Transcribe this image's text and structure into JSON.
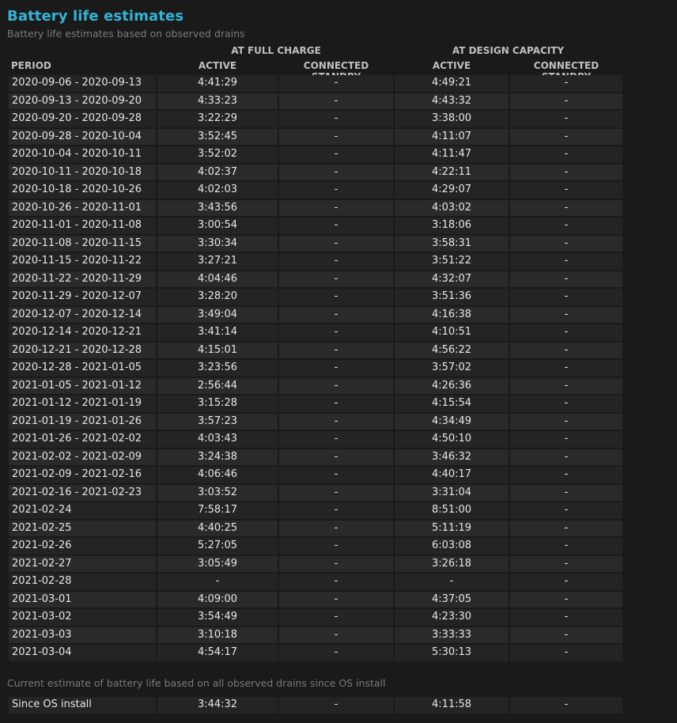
{
  "section": {
    "title": "Battery life estimates",
    "subtitle": "Battery life estimates based on observed drains"
  },
  "header": {
    "group_full": "AT FULL CHARGE",
    "group_design": "AT DESIGN CAPACITY",
    "period": "PERIOD",
    "active_full": "ACTIVE",
    "standby_full": "CONNECTED STANDBY",
    "active_design": "ACTIVE",
    "standby_design": "CONNECTED STANDBY"
  },
  "rows": [
    {
      "period": "2020-09-06 - 2020-09-13",
      "active_full": "4:41:29",
      "standby_full": "-",
      "active_design": "4:49:21",
      "standby_design": "-"
    },
    {
      "period": "2020-09-13 - 2020-09-20",
      "active_full": "4:33:23",
      "standby_full": "-",
      "active_design": "4:43:32",
      "standby_design": "-"
    },
    {
      "period": "2020-09-20 - 2020-09-28",
      "active_full": "3:22:29",
      "standby_full": "-",
      "active_design": "3:38:00",
      "standby_design": "-"
    },
    {
      "period": "2020-09-28 - 2020-10-04",
      "active_full": "3:52:45",
      "standby_full": "-",
      "active_design": "4:11:07",
      "standby_design": "-"
    },
    {
      "period": "2020-10-04 - 2020-10-11",
      "active_full": "3:52:02",
      "standby_full": "-",
      "active_design": "4:11:47",
      "standby_design": "-"
    },
    {
      "period": "2020-10-11 - 2020-10-18",
      "active_full": "4:02:37",
      "standby_full": "-",
      "active_design": "4:22:11",
      "standby_design": "-"
    },
    {
      "period": "2020-10-18 - 2020-10-26",
      "active_full": "4:02:03",
      "standby_full": "-",
      "active_design": "4:29:07",
      "standby_design": "-"
    },
    {
      "period": "2020-10-26 - 2020-11-01",
      "active_full": "3:43:56",
      "standby_full": "-",
      "active_design": "4:03:02",
      "standby_design": "-"
    },
    {
      "period": "2020-11-01 - 2020-11-08",
      "active_full": "3:00:54",
      "standby_full": "-",
      "active_design": "3:18:06",
      "standby_design": "-"
    },
    {
      "period": "2020-11-08 - 2020-11-15",
      "active_full": "3:30:34",
      "standby_full": "-",
      "active_design": "3:58:31",
      "standby_design": "-"
    },
    {
      "period": "2020-11-15 - 2020-11-22",
      "active_full": "3:27:21",
      "standby_full": "-",
      "active_design": "3:51:22",
      "standby_design": "-"
    },
    {
      "period": "2020-11-22 - 2020-11-29",
      "active_full": "4:04:46",
      "standby_full": "-",
      "active_design": "4:32:07",
      "standby_design": "-"
    },
    {
      "period": "2020-11-29 - 2020-12-07",
      "active_full": "3:28:20",
      "standby_full": "-",
      "active_design": "3:51:36",
      "standby_design": "-"
    },
    {
      "period": "2020-12-07 - 2020-12-14",
      "active_full": "3:49:04",
      "standby_full": "-",
      "active_design": "4:16:38",
      "standby_design": "-"
    },
    {
      "period": "2020-12-14 - 2020-12-21",
      "active_full": "3:41:14",
      "standby_full": "-",
      "active_design": "4:10:51",
      "standby_design": "-"
    },
    {
      "period": "2020-12-21 - 2020-12-28",
      "active_full": "4:15:01",
      "standby_full": "-",
      "active_design": "4:56:22",
      "standby_design": "-"
    },
    {
      "period": "2020-12-28 - 2021-01-05",
      "active_full": "3:23:56",
      "standby_full": "-",
      "active_design": "3:57:02",
      "standby_design": "-"
    },
    {
      "period": "2021-01-05 - 2021-01-12",
      "active_full": "2:56:44",
      "standby_full": "-",
      "active_design": "4:26:36",
      "standby_design": "-"
    },
    {
      "period": "2021-01-12 - 2021-01-19",
      "active_full": "3:15:28",
      "standby_full": "-",
      "active_design": "4:15:54",
      "standby_design": "-"
    },
    {
      "period": "2021-01-19 - 2021-01-26",
      "active_full": "3:57:23",
      "standby_full": "-",
      "active_design": "4:34:49",
      "standby_design": "-"
    },
    {
      "period": "2021-01-26 - 2021-02-02",
      "active_full": "4:03:43",
      "standby_full": "-",
      "active_design": "4:50:10",
      "standby_design": "-"
    },
    {
      "period": "2021-02-02 - 2021-02-09",
      "active_full": "3:24:38",
      "standby_full": "-",
      "active_design": "3:46:32",
      "standby_design": "-"
    },
    {
      "period": "2021-02-09 - 2021-02-16",
      "active_full": "4:06:46",
      "standby_full": "-",
      "active_design": "4:40:17",
      "standby_design": "-"
    },
    {
      "period": "2021-02-16 - 2021-02-23",
      "active_full": "3:03:52",
      "standby_full": "-",
      "active_design": "3:31:04",
      "standby_design": "-"
    },
    {
      "period": "2021-02-24",
      "active_full": "7:58:17",
      "standby_full": "-",
      "active_design": "8:51:00",
      "standby_design": "-"
    },
    {
      "period": "2021-02-25",
      "active_full": "4:40:25",
      "standby_full": "-",
      "active_design": "5:11:19",
      "standby_design": "-"
    },
    {
      "period": "2021-02-26",
      "active_full": "5:27:05",
      "standby_full": "-",
      "active_design": "6:03:08",
      "standby_design": "-"
    },
    {
      "period": "2021-02-27",
      "active_full": "3:05:49",
      "standby_full": "-",
      "active_design": "3:26:18",
      "standby_design": "-"
    },
    {
      "period": "2021-02-28",
      "active_full": "-",
      "standby_full": "-",
      "active_design": "-",
      "standby_design": "-"
    },
    {
      "period": "2021-03-01",
      "active_full": "4:09:00",
      "standby_full": "-",
      "active_design": "4:37:05",
      "standby_design": "-"
    },
    {
      "period": "2021-03-02",
      "active_full": "3:54:49",
      "standby_full": "-",
      "active_design": "4:23:30",
      "standby_design": "-"
    },
    {
      "period": "2021-03-03",
      "active_full": "3:10:18",
      "standby_full": "-",
      "active_design": "3:33:33",
      "standby_design": "-"
    },
    {
      "period": "2021-03-04",
      "active_full": "4:54:17",
      "standby_full": "-",
      "active_design": "5:30:13",
      "standby_design": "-"
    }
  ],
  "summary": {
    "label": "Current estimate of battery life based on all observed drains since OS install",
    "period": "Since OS install",
    "active_full": "3:44:32",
    "standby_full": "-",
    "active_design": "4:11:58",
    "standby_design": "-"
  }
}
